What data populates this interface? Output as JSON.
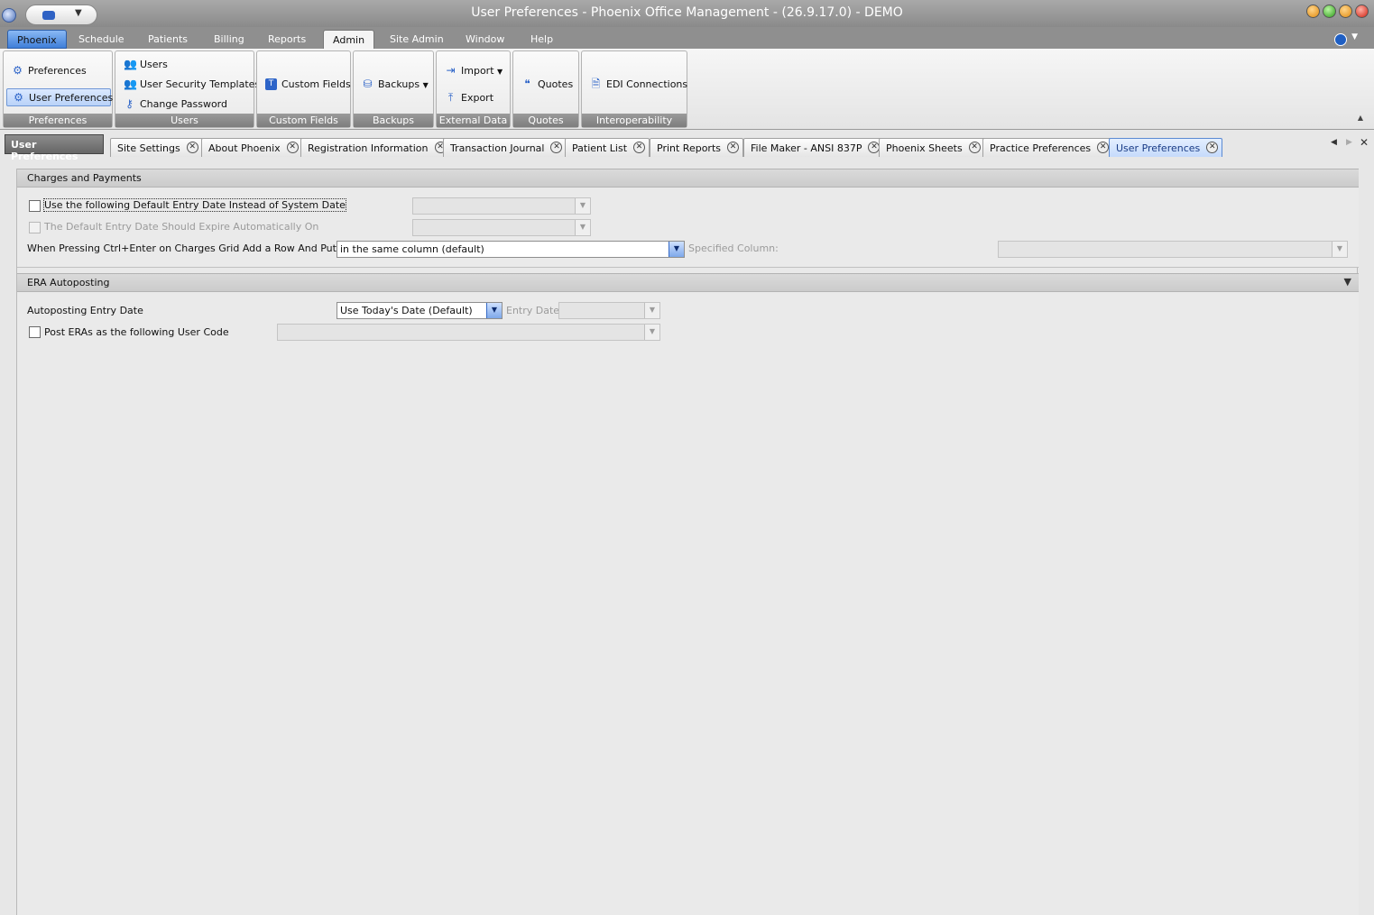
{
  "window": {
    "title": "User Preferences - Phoenix Office Management - (26.9.17.0) - DEMO"
  },
  "menu": {
    "items": [
      "Phoenix",
      "Schedule",
      "Patients",
      "Billing",
      "Reports",
      "Admin",
      "Site Admin",
      "Window",
      "Help"
    ],
    "active": "Admin"
  },
  "ribbon": {
    "preferences": {
      "label": "Preferences",
      "preferences_btn": "Preferences",
      "user_preferences_btn": "User Preferences"
    },
    "users": {
      "label": "Users",
      "users_btn": "Users",
      "security_btn": "User Security Templates",
      "password_btn": "Change Password"
    },
    "custom_fields": {
      "label": "Custom Fields",
      "btn": "Custom Fields"
    },
    "backups": {
      "label": "Backups",
      "btn": "Backups"
    },
    "external": {
      "label": "External Data",
      "import_btn": "Import",
      "export_btn": "Export"
    },
    "quotes": {
      "label": "Quotes",
      "btn": "Quotes"
    },
    "interop": {
      "label": "Interoperability",
      "btn": "EDI Connections"
    }
  },
  "tabs": {
    "strip_title": "User Preferences",
    "items": [
      "Site Settings",
      "About Phoenix",
      "Registration Information",
      "Transaction Journal",
      "Patient List",
      "Print Reports",
      "File Maker - ANSI 837P",
      "Phoenix Sheets",
      "Practice Preferences",
      "User Preferences"
    ],
    "active": "User Preferences"
  },
  "charges": {
    "header": "Charges and Payments",
    "default_entry_label": "Use the following Default Entry Date Instead of System Date",
    "default_entry_checked": false,
    "expire_label": "The Default Entry Date Should Expire Automatically On",
    "expire_checked": false,
    "ctrl_enter_label": "When Pressing Ctrl+Enter on Charges Grid Add a Row And Put Cursor",
    "ctrl_enter_value": "in the same column (default)",
    "specified_column_label": "Specified Column:"
  },
  "era": {
    "header": "ERA Autoposting",
    "entry_date_label": "Autoposting Entry Date",
    "entry_date_value": "Use Today's Date (Default)",
    "entry_date_field_label": "Entry Date",
    "post_as_label": "Post ERAs as the following User Code",
    "post_as_checked": false
  }
}
